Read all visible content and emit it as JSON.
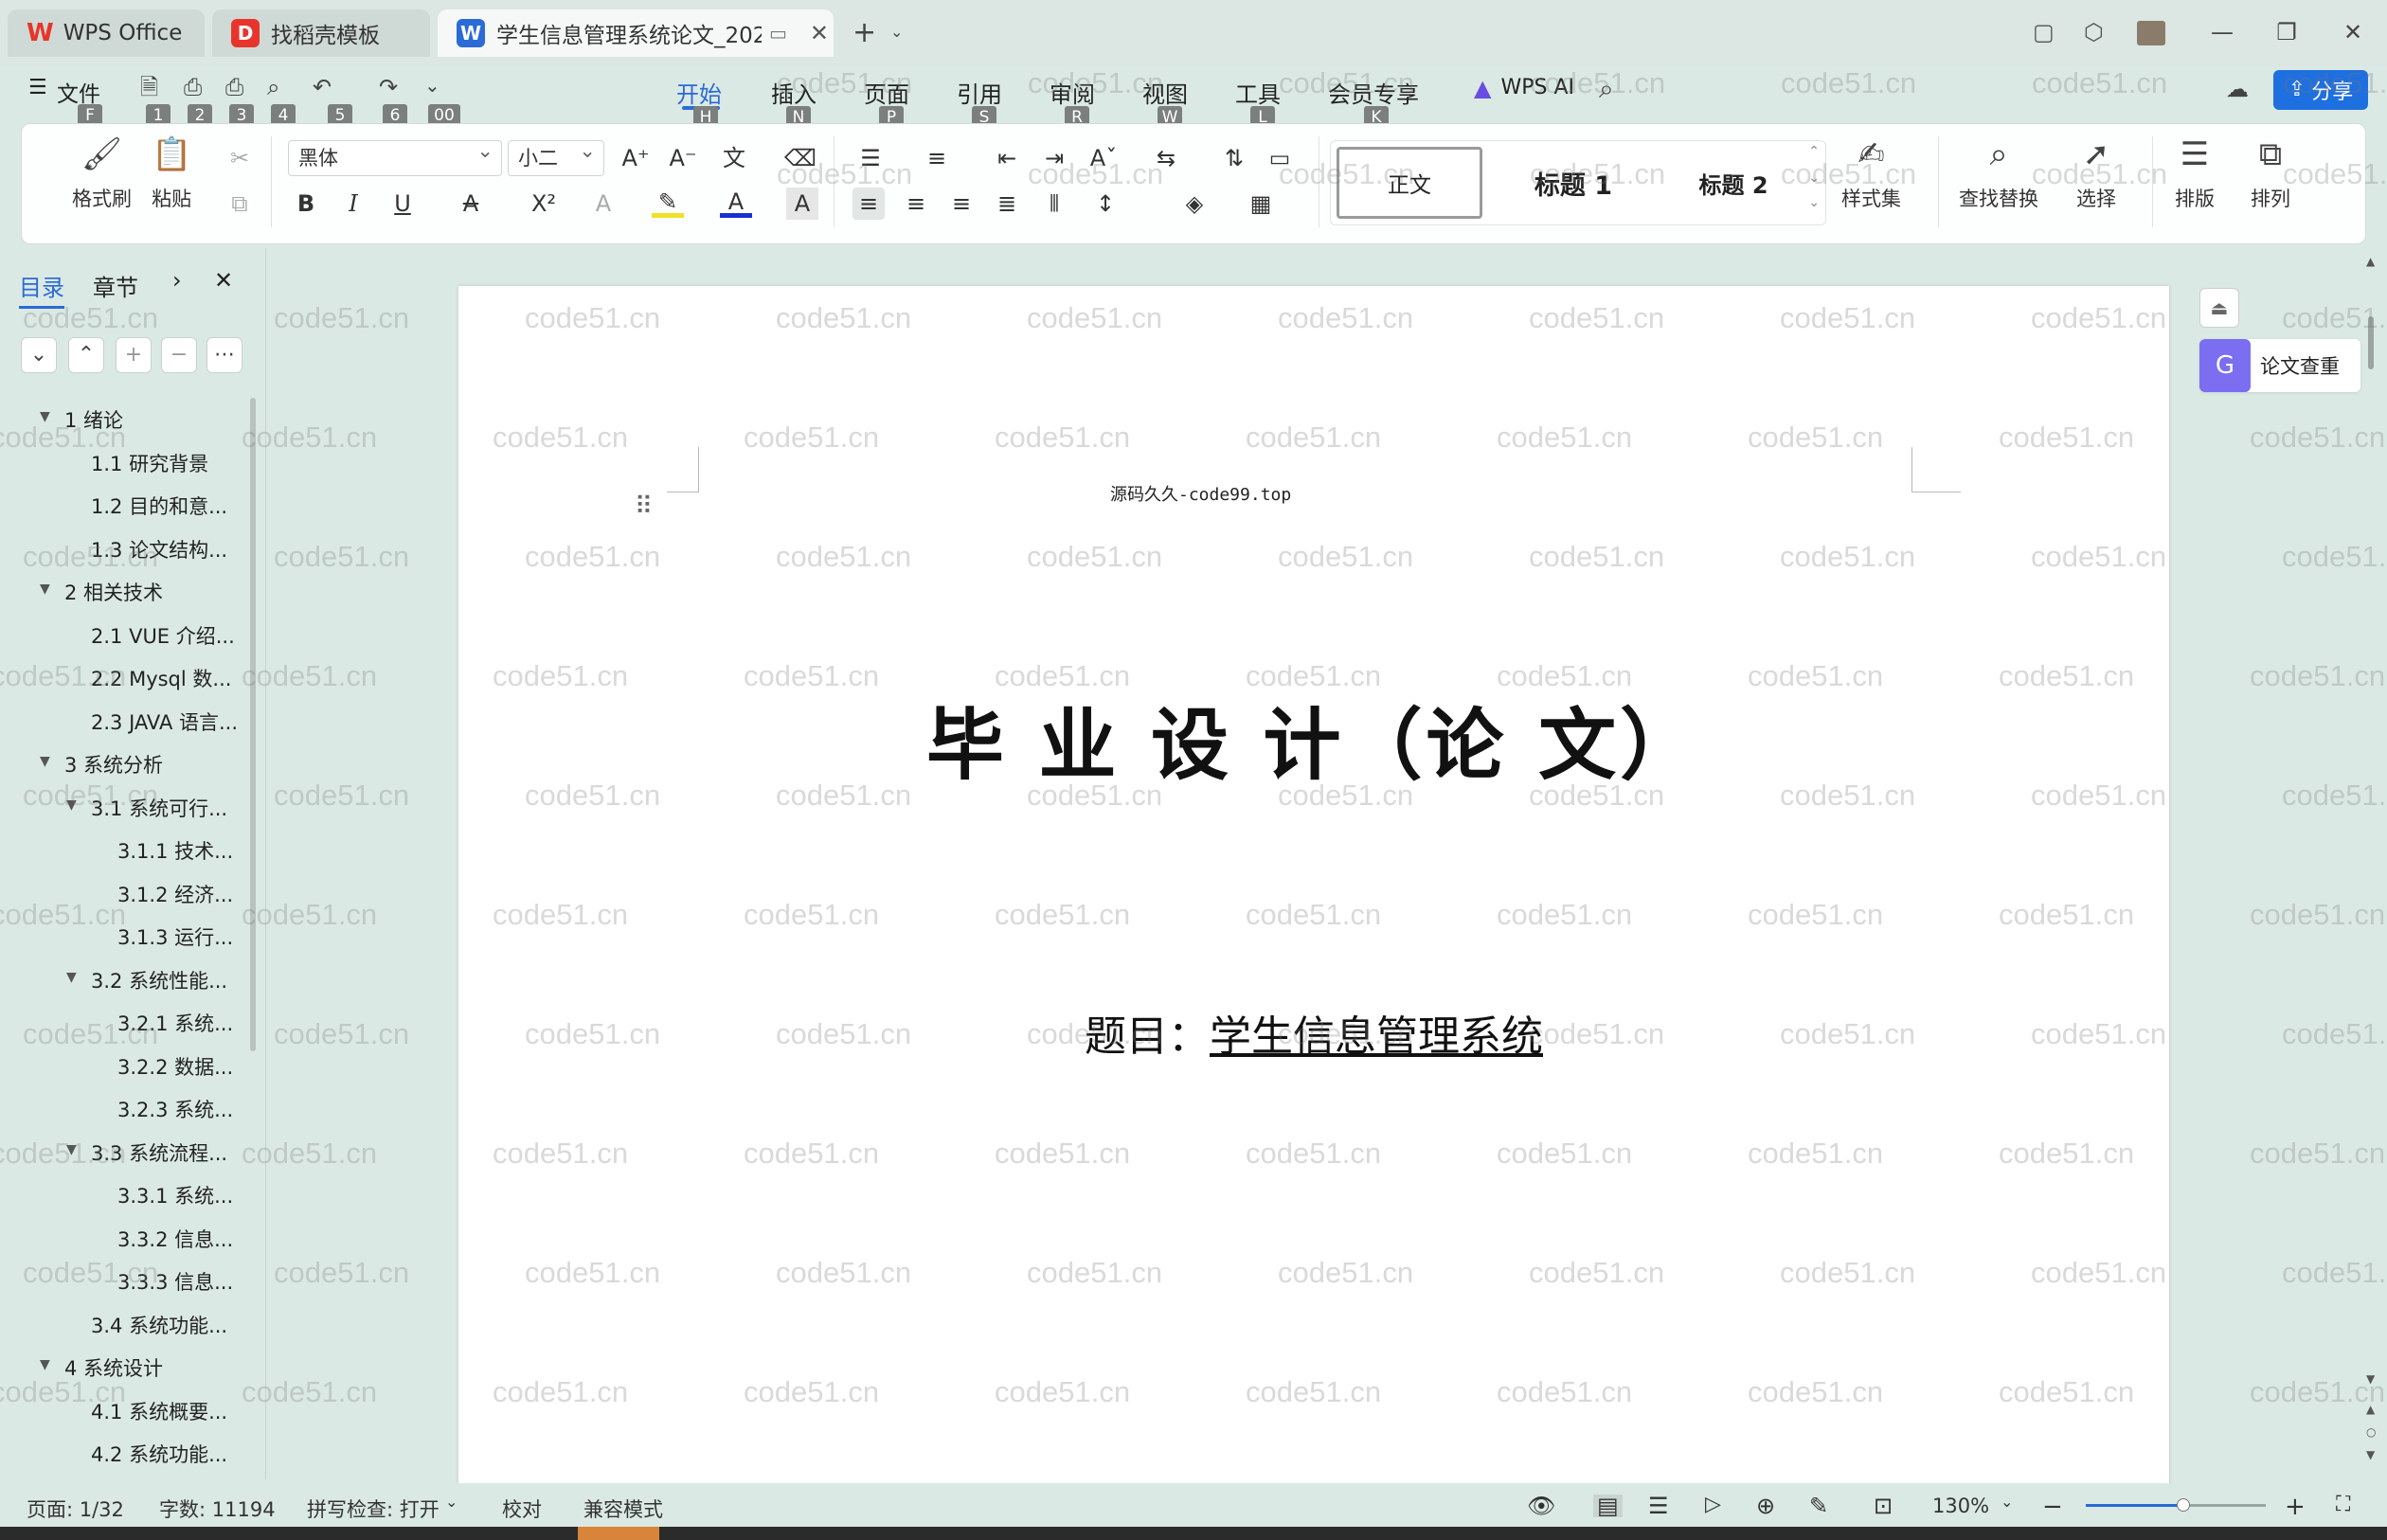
{
  "tabs": {
    "wps": "WPS Office",
    "template": "找稻壳模板",
    "document": "学生信息管理系统论文_20230"
  },
  "menu": {
    "file": "文件",
    "items": [
      "开始",
      "插入",
      "页面",
      "引用",
      "审阅",
      "视图",
      "工具",
      "会员专享"
    ],
    "keytips": [
      "H",
      "N",
      "P",
      "S",
      "R",
      "W",
      "L",
      "K"
    ],
    "file_keytip": "F",
    "qa_keytips": [
      "1",
      "2",
      "3",
      "4",
      "5",
      "6",
      "00"
    ],
    "wps_ai": "WPS AI",
    "share": "分享"
  },
  "ribbon": {
    "format_painter": "格式刷",
    "paste": "粘贴",
    "font_name": "黑体",
    "font_size": "小二",
    "style_normal": "正文",
    "style_h1": "标题 1",
    "style_h2": "标题 2",
    "style_set": "样式集",
    "find_replace": "查找替换",
    "select": "选择",
    "layout": "排版",
    "arrange": "排列",
    "bold": "B",
    "italic": "I",
    "underline": "U",
    "strike": "A",
    "superscript": "X²"
  },
  "nav": {
    "tab_toc": "目录",
    "tab_chapter": "章节",
    "items": [
      {
        "label": "1  绪论",
        "level": 1,
        "expand": "▼"
      },
      {
        "label": "1.1  研究背景",
        "level": 2,
        "expand": ""
      },
      {
        "label": "1.2 目的和意...",
        "level": 2,
        "expand": ""
      },
      {
        "label": "1.3  论文结构...",
        "level": 2,
        "expand": ""
      },
      {
        "label": "2  相关技术",
        "level": 1,
        "expand": "▼"
      },
      {
        "label": "2.1 VUE 介绍...",
        "level": 2,
        "expand": ""
      },
      {
        "label": "2.2 Mysql 数...",
        "level": 2,
        "expand": ""
      },
      {
        "label": "2.3 JAVA 语言...",
        "level": 2,
        "expand": ""
      },
      {
        "label": "3  系统分析",
        "level": 1,
        "expand": "▼"
      },
      {
        "label": "3.1 系统可行...",
        "level": 2,
        "expand": "▼"
      },
      {
        "label": "3.1.1  技术...",
        "level": 3,
        "expand": ""
      },
      {
        "label": "3.1.2  经济...",
        "level": 3,
        "expand": ""
      },
      {
        "label": "3.1.3  运行...",
        "level": 3,
        "expand": ""
      },
      {
        "label": "3.2 系统性能...",
        "level": 2,
        "expand": "▼"
      },
      {
        "label": "3.2.1  系统...",
        "level": 3,
        "expand": ""
      },
      {
        "label": "3.2.2  数据...",
        "level": 3,
        "expand": ""
      },
      {
        "label": "3.2.3 系统...",
        "level": 3,
        "expand": ""
      },
      {
        "label": "3.3 系统流程...",
        "level": 2,
        "expand": "▼"
      },
      {
        "label": "3.3.1 系统...",
        "level": 3,
        "expand": ""
      },
      {
        "label": "3.3.2 信息...",
        "level": 3,
        "expand": ""
      },
      {
        "label": "3.3.3 信息...",
        "level": 3,
        "expand": ""
      },
      {
        "label": "3.4 系统功能...",
        "level": 2,
        "expand": ""
      },
      {
        "label": "4  系统设计",
        "level": 1,
        "expand": "▼"
      },
      {
        "label": "4.1 系统概要...",
        "level": 2,
        "expand": ""
      },
      {
        "label": "4.2 系统功能...",
        "level": 2,
        "expand": ""
      }
    ]
  },
  "document": {
    "header_text": "源码久久-code99.top",
    "title": "毕 业 设 计（论 文）",
    "subject_label": "题目：",
    "subject_value": "学生信息管理系统"
  },
  "side_panel": {
    "plagiarism_check": "论文查重"
  },
  "watermark": "code51.cn",
  "status": {
    "page": "页面: 1/32",
    "words": "字数: 11194",
    "spell": "拼写检查: 打开",
    "proof": "校对",
    "compat": "兼容模式",
    "zoom": "130%"
  },
  "colors": {
    "accent": "#2a6bd6",
    "background": "#dbe9e4",
    "share_button": "#1e6fe0",
    "wps_red": "#e8352b"
  }
}
